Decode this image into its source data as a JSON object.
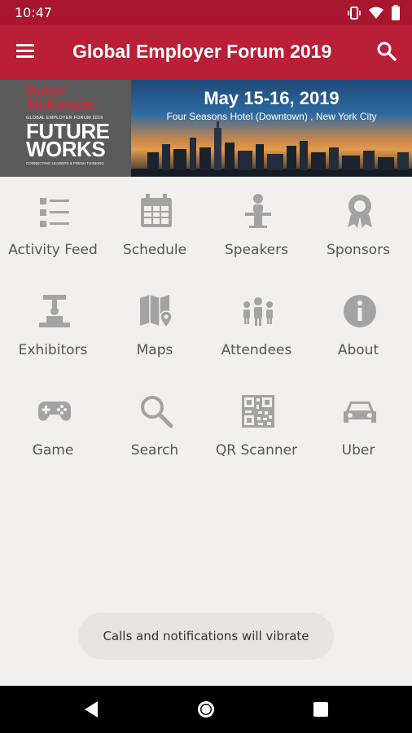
{
  "status_bar": {
    "time": "10:47"
  },
  "app_bar": {
    "title": "Global Employer Forum 2019"
  },
  "banner": {
    "brand_line1": "Baker",
    "brand_line2": "McKenzie.",
    "brand_sub": "GLOBAL EMPLOYER FORUM 2019",
    "brand_big1": "FUTURE",
    "brand_big2": "WORKS",
    "brand_tag": "CONNECTING LEADERS & FRESH THINKING",
    "date": "May 15-16, 2019",
    "venue": "Four Seasons Hotel (Downtown) , New York City"
  },
  "tiles": [
    {
      "label": "Activity Feed",
      "icon": "activity-feed-icon"
    },
    {
      "label": "Schedule",
      "icon": "calendar-icon"
    },
    {
      "label": "Speakers",
      "icon": "speaker-podium-icon"
    },
    {
      "label": "Sponsors",
      "icon": "ribbon-award-icon"
    },
    {
      "label": "Exhibitors",
      "icon": "exhibitor-booth-icon"
    },
    {
      "label": "Maps",
      "icon": "map-pin-icon"
    },
    {
      "label": "Attendees",
      "icon": "people-group-icon"
    },
    {
      "label": "About",
      "icon": "info-icon"
    },
    {
      "label": "Game",
      "icon": "gamepad-icon"
    },
    {
      "label": "Search",
      "icon": "search-icon"
    },
    {
      "label": "QR Scanner",
      "icon": "qr-code-icon"
    },
    {
      "label": "Uber",
      "icon": "car-icon"
    }
  ],
  "toast": {
    "text": "Calls and notifications will vibrate"
  },
  "colors": {
    "app_bar": "#b91f37",
    "status_bar": "#a8162f",
    "icon": "#a3a3a3",
    "background": "#f1f0ed"
  }
}
